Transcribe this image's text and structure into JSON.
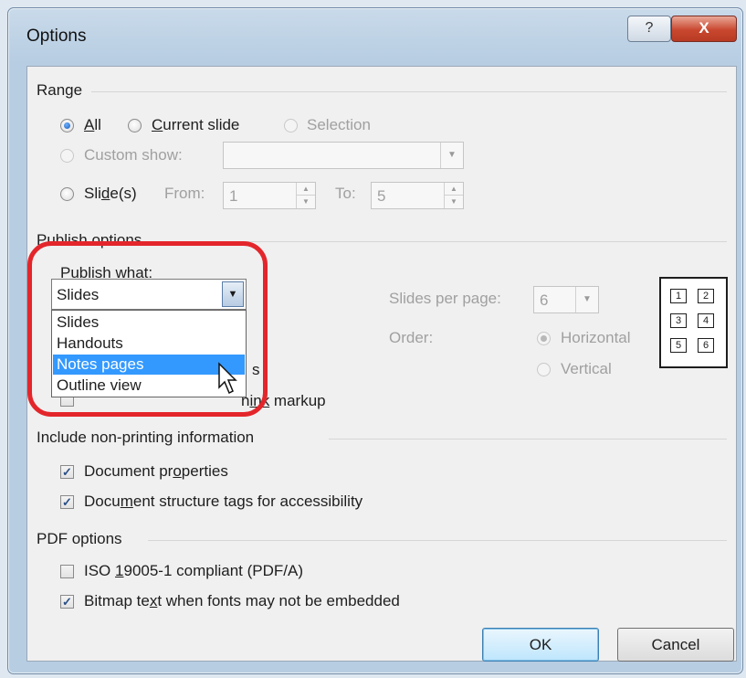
{
  "window": {
    "title": "Options",
    "help_glyph": "?",
    "close_glyph": "X"
  },
  "range": {
    "heading": "Range",
    "all": {
      "pre": "",
      "ul": "A",
      "post": "ll",
      "selected": true
    },
    "current_slide": {
      "pre": "",
      "ul": "C",
      "post": "urrent slide"
    },
    "selection": {
      "label": "Selection",
      "disabled": true
    },
    "custom_show": {
      "label": "Custom show:",
      "disabled": true,
      "value": ""
    },
    "slides": {
      "pre": "Sli",
      "ul": "d",
      "post": "e(s)",
      "from_label": "From:",
      "from_value": "1",
      "to_label": "To:",
      "to_value": "5"
    }
  },
  "publish": {
    "heading": "Publish options",
    "what_label_pre": "Publish ",
    "what_label_ul": "w",
    "what_label_post": "hat:",
    "selected_value": "Slides",
    "options": [
      "Slides",
      "Handouts",
      "Notes pages",
      "Outline view"
    ],
    "highlighted": "Notes pages",
    "hidden_frame_tail": "s",
    "ink_tail_pre": "n",
    "ink_tail_mid": "ink",
    "ink_tail_post": " markup",
    "slides_per_page_label": "Slides per page:",
    "slides_per_page_value": "6",
    "order_label": "Order:",
    "order_horizontal": "Horizontal",
    "order_vertical": "Vertical",
    "grid_numbers": [
      "1",
      "2",
      "3",
      "4",
      "5",
      "6"
    ]
  },
  "nonprinting": {
    "heading": "Include non-printing information",
    "doc_props": {
      "pre": "Document pr",
      "ul": "o",
      "post": "perties",
      "checked": true
    },
    "doc_tags": {
      "pre": "Docu",
      "ul": "m",
      "post": "ent structure tags for accessibility",
      "checked": true
    }
  },
  "pdf": {
    "heading": "PDF options",
    "iso": {
      "pre": "ISO ",
      "ul": "1",
      "post": "9005-1 compliant (PDF/A)",
      "checked": false
    },
    "bitmap": {
      "pre": "Bitmap te",
      "ul": "x",
      "post": "t when fonts may not be embedded",
      "checked": true
    }
  },
  "buttons": {
    "ok": "OK",
    "cancel": "Cancel"
  },
  "colors": {
    "highlight": "#3399ff",
    "annotation": "#e3262b",
    "titlebar": "#c9daea"
  },
  "icons": {
    "help": "help-icon",
    "close": "close-icon",
    "cursor": "mouse-pointer-icon",
    "check": "checkmark-icon"
  }
}
